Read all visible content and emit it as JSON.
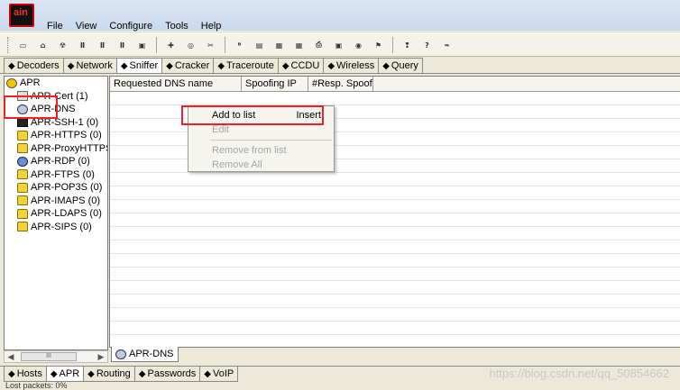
{
  "window": {
    "logo_text": "ain"
  },
  "menu": [
    "File",
    "View",
    "Configure",
    "Tools",
    "Help"
  ],
  "toolbar_icons": [
    "open-icon",
    "save-icon",
    "apr-icon",
    "reset-icon",
    "reset-icon-2",
    "reset-icon-3",
    "display-icon",
    "add-icon",
    "sniffer-icon",
    "cracker-icon",
    "base64-icon",
    "cert-icon",
    "ntlm-icon",
    "hash-icon",
    "key-icon",
    "lsa-icon",
    "wireless-icon",
    "router-icon",
    "help-icon",
    "info-icon",
    "about-icon"
  ],
  "top_tabs": [
    {
      "label": "Decoders",
      "icon": "decoder-icon"
    },
    {
      "label": "Network",
      "icon": "network-icon"
    },
    {
      "label": "Sniffer",
      "icon": "sniffer-icon"
    },
    {
      "label": "Cracker",
      "icon": "cracker-icon"
    },
    {
      "label": "Traceroute",
      "icon": "traceroute-icon"
    },
    {
      "label": "CCDU",
      "icon": "ccdu-icon"
    },
    {
      "label": "Wireless",
      "icon": "wireless-icon"
    },
    {
      "label": "Query",
      "icon": "query-icon"
    }
  ],
  "tree": {
    "root": "APR",
    "items": [
      {
        "label": "APR-Cert (1)",
        "icon": "cert"
      },
      {
        "label": "APR-DNS",
        "icon": "net"
      },
      {
        "label": "APR-SSH-1 (0)",
        "icon": "ssh"
      },
      {
        "label": "APR-HTTPS (0)",
        "icon": "lock"
      },
      {
        "label": "APR-ProxyHTTPS (0",
        "icon": "lock"
      },
      {
        "label": "APR-RDP (0)",
        "icon": "rdp"
      },
      {
        "label": "APR-FTPS (0)",
        "icon": "lock"
      },
      {
        "label": "APR-POP3S (0)",
        "icon": "lock"
      },
      {
        "label": "APR-IMAPS (0)",
        "icon": "lock"
      },
      {
        "label": "APR-LDAPS (0)",
        "icon": "lock"
      },
      {
        "label": "APR-SIPS (0)",
        "icon": "lock"
      }
    ]
  },
  "scrollbar": {
    "thumb_label": "III"
  },
  "grid": {
    "columns": [
      "Requested DNS name",
      "Spoofing IP",
      "#Resp. Spoof..."
    ]
  },
  "subtab": {
    "label": "APR-DNS"
  },
  "context_menu": {
    "items": [
      {
        "label": "Add to list",
        "shortcut": "Insert",
        "enabled": true
      },
      {
        "label": "Edit",
        "shortcut": "",
        "enabled": false
      },
      {
        "label": "Remove from list",
        "shortcut": "",
        "enabled": false
      },
      {
        "label": "Remove All",
        "shortcut": "",
        "enabled": false
      }
    ]
  },
  "bottom_tabs": [
    {
      "label": "Hosts",
      "icon": "hosts-icon"
    },
    {
      "label": "APR",
      "icon": "apr-icon"
    },
    {
      "label": "Routing",
      "icon": "routing-icon"
    },
    {
      "label": "Passwords",
      "icon": "passwords-icon"
    },
    {
      "label": "VoIP",
      "icon": "voip-icon"
    }
  ],
  "watermark": "https://blog.csdn.net/qq_50854662",
  "status": {
    "text": "Lost packets: 0%"
  },
  "colors": {
    "highlight": "#e22222",
    "tree_bg": "#ffffff",
    "chrome_bg": "#ece9d8"
  }
}
